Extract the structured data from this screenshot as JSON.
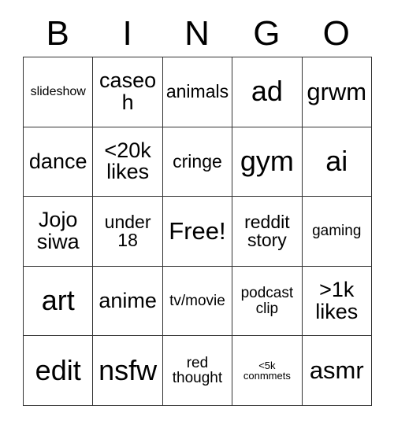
{
  "card": {
    "title": "BINGO",
    "headers": [
      "B",
      "I",
      "N",
      "G",
      "O"
    ],
    "rows": [
      [
        {
          "text": "slideshow",
          "size": "fs-xs"
        },
        {
          "text": "caseoh",
          "size": "fs-l"
        },
        {
          "text": "animals",
          "size": "fs-m"
        },
        {
          "text": "ad",
          "size": "fs-xxl"
        },
        {
          "text": "grwm",
          "size": "fs-xl"
        }
      ],
      [
        {
          "text": "dance",
          "size": "fs-l"
        },
        {
          "text": "<20k\nlikes",
          "size": "fs-l"
        },
        {
          "text": "cringe",
          "size": "fs-m"
        },
        {
          "text": "gym",
          "size": "fs-xxl"
        },
        {
          "text": "ai",
          "size": "fs-xxl"
        }
      ],
      [
        {
          "text": "Jojo\nsiwa",
          "size": "fs-l"
        },
        {
          "text": "under\n18",
          "size": "fs-m"
        },
        {
          "text": "Free!",
          "size": "fs-xl"
        },
        {
          "text": "reddit\nstory",
          "size": "fs-m"
        },
        {
          "text": "gaming",
          "size": "fs-s"
        }
      ],
      [
        {
          "text": "art",
          "size": "fs-xxl"
        },
        {
          "text": "anime",
          "size": "fs-l"
        },
        {
          "text": "tv/movie",
          "size": "fs-s"
        },
        {
          "text": "podcast\nclip",
          "size": "fs-s"
        },
        {
          "text": ">1k\nlikes",
          "size": "fs-l"
        }
      ],
      [
        {
          "text": "edit",
          "size": "fs-xxl"
        },
        {
          "text": "nsfw",
          "size": "fs-xxl"
        },
        {
          "text": "red\nthought",
          "size": "fs-s"
        },
        {
          "text": "<5k\nconmmets",
          "size": "fs-xxs"
        },
        {
          "text": "asmr",
          "size": "fs-xl"
        }
      ]
    ],
    "free_space": "Free!",
    "colors": {
      "background": "#ffffff",
      "text": "#000000",
      "border": "#333333"
    }
  }
}
